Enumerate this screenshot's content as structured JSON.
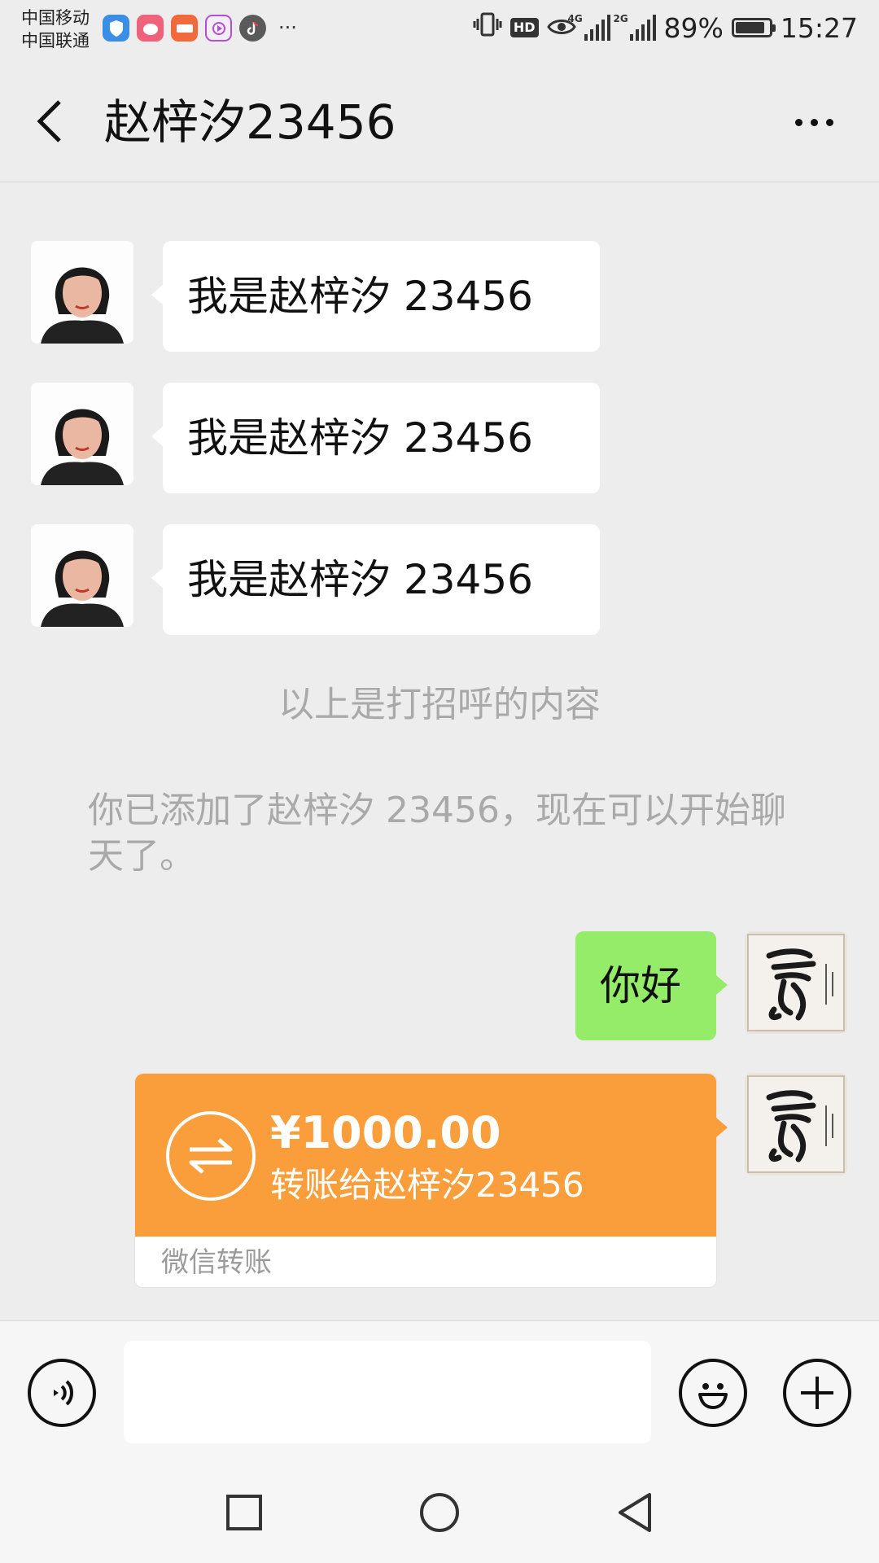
{
  "status_bar": {
    "carrier_1": "中国移动",
    "carrier_2": "中国联通",
    "net_1": "4G",
    "net_2": "2G",
    "hd": "HD",
    "battery": "89%",
    "battery_level": 0.89,
    "time": "15:27",
    "more": "···"
  },
  "header": {
    "title": "赵梓汐23456"
  },
  "messages": {
    "greeting_1": "我是赵梓汐 23456",
    "greeting_2": "我是赵梓汐 23456",
    "greeting_3": "我是赵梓汐 23456",
    "system_greeting_note": "以上是打招呼的内容",
    "system_added_note": "你已添加了赵梓汐 23456，现在可以开始聊天了。",
    "outgoing_text": "你好"
  },
  "transfer": {
    "amount": "¥1000.00",
    "description": "转账给赵梓汐23456",
    "footer": "微信转账"
  },
  "colors": {
    "background": "#ededed",
    "outgoing_bubble": "#95ec69",
    "transfer_orange": "#fa9d3b"
  }
}
